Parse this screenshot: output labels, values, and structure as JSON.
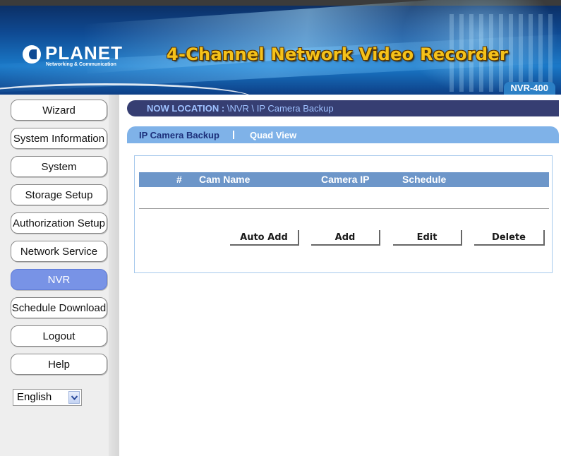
{
  "header": {
    "logo_name": "PLANET",
    "logo_tagline": "Networking & Communication",
    "title": "4-Channel Network Video Recorder",
    "model": "NVR-400"
  },
  "sidebar": {
    "items": [
      {
        "label": "Wizard",
        "active": false
      },
      {
        "label": "System Information",
        "active": false
      },
      {
        "label": "System",
        "active": false
      },
      {
        "label": "Storage Setup",
        "active": false
      },
      {
        "label": "Authorization Setup",
        "active": false
      },
      {
        "label": "Network Service",
        "active": false
      },
      {
        "label": "NVR",
        "active": true
      },
      {
        "label": "Schedule Download",
        "active": false
      },
      {
        "label": "Logout",
        "active": false
      },
      {
        "label": "Help",
        "active": false
      }
    ],
    "language": {
      "selected": "English"
    }
  },
  "location": {
    "label": "NOW LOCATION :",
    "path": " \\NVR \\ IP Camera Backup"
  },
  "tabs": [
    {
      "label": "IP Camera Backup",
      "current": true
    },
    {
      "label": "Quad View",
      "current": false
    }
  ],
  "table": {
    "columns": [
      "#",
      "Cam Name",
      "Camera IP",
      "Schedule"
    ],
    "rows": []
  },
  "actions": {
    "auto_add": "Auto Add",
    "add": "Add",
    "edit": "Edit",
    "delete": "Delete"
  },
  "colors": {
    "active_nav": "#7893e6",
    "location_bar": "#363e72",
    "tab_bar": "#7fb2e8",
    "table_header": "#6d96c9",
    "title_gold": "#f5c21a"
  }
}
